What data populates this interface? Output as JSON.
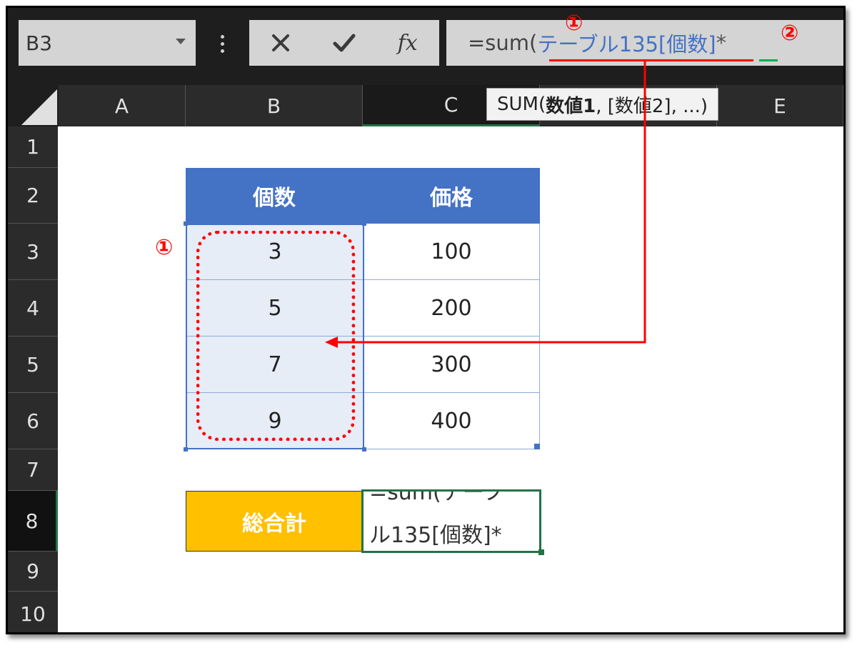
{
  "name_box": {
    "value": "B3"
  },
  "formula_bar": {
    "cancel_icon": "×",
    "enter_icon": "✔",
    "fx_label": "fx",
    "formula_prefix": "=sum(",
    "formula_ref": "テーブル135[個数]",
    "formula_suffix": "*"
  },
  "tooltip": {
    "prefix": "SUM(",
    "bold_arg": "数値1",
    "rest": ", [数値2], ...)"
  },
  "columns": [
    "A",
    "B",
    "C",
    "E"
  ],
  "rows": [
    "1",
    "2",
    "3",
    "4",
    "5",
    "6",
    "7",
    "8",
    "9",
    "10"
  ],
  "table": {
    "headers": [
      "個数",
      "価格"
    ],
    "rows": [
      [
        "3",
        "100"
      ],
      [
        "5",
        "200"
      ],
      [
        "7",
        "300"
      ],
      [
        "9",
        "400"
      ]
    ]
  },
  "total": {
    "label": "総合計",
    "edit_line1": "=sum(テーブ",
    "edit_line2": "ル135[個数]*"
  },
  "annotations": {
    "marker_1": "①",
    "marker_2": "②",
    "color_red": "#ff0000",
    "color_green": "#00b050"
  },
  "colors": {
    "table_header": "#4472c4",
    "total_label": "#ffc000",
    "excel_green": "#217346"
  }
}
